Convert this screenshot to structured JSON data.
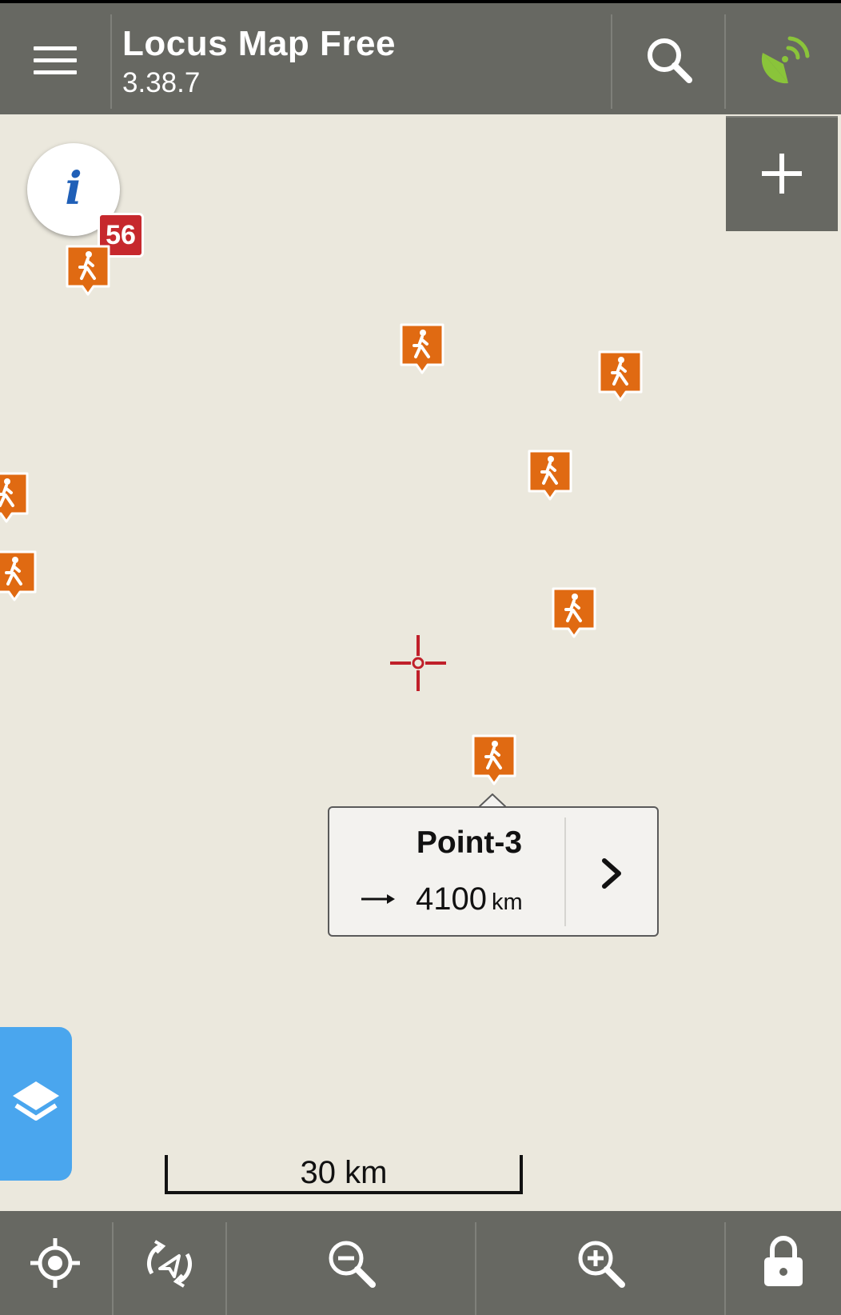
{
  "header": {
    "title": "Locus Map Free",
    "version": "3.38.7"
  },
  "info_badge": {
    "count": "56"
  },
  "map": {
    "poi_icon": "hiking-icon",
    "poi_count": 8
  },
  "popup": {
    "name": "Point-3",
    "distance_value": "4100",
    "distance_unit": "km"
  },
  "scale": {
    "label": "30 km"
  },
  "icons": {
    "menu": "hamburger-menu-icon",
    "search": "search-icon",
    "gps": "gps-satellite-icon",
    "add": "plus-icon",
    "info": "info-icon",
    "layers": "layers-icon",
    "locate": "my-location-icon",
    "rotate": "map-rotate-icon",
    "zoom_out": "zoom-out-icon",
    "zoom_in": "zoom-in-icon",
    "lock": "lock-icon"
  },
  "colors": {
    "bar": "#676862",
    "map_bg": "#ebe8dd",
    "poi": "#e06a12",
    "badge": "#c6282d",
    "gps_active": "#8ac43a",
    "layers": "#4aa6ee",
    "crosshair": "#c0202a"
  }
}
